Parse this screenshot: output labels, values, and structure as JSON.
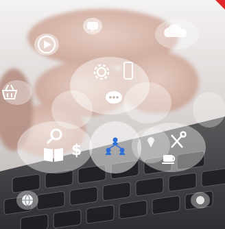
{
  "image": {
    "description_icons": [
      "play-icon",
      "chat-bubble-icon",
      "cloud-icon",
      "shopping-basket-icon",
      "gear-icon",
      "smartphone-icon",
      "speech-bubble-dots-icon",
      "search-icon",
      "book-icon",
      "dollar-icon",
      "network-people-icon",
      "tools-icon",
      "coffee-cup-icon",
      "globe-icon"
    ],
    "colors": {
      "accent_blue": "#2f6fd6",
      "corner_red": "#e0262b",
      "bubble_white": "#ffffff",
      "keyboard_dark": "#2a2a2e"
    }
  }
}
